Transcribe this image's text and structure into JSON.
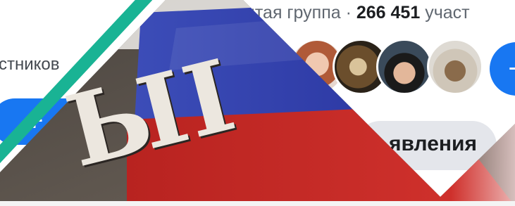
{
  "group": {
    "meta_prefix": "рытая группа · ",
    "members_count": "266 451",
    "meta_suffix": " участ"
  },
  "members_caption": "стников",
  "actions": {
    "join_symbol": "+",
    "invite_symbol": "+"
  },
  "tabs": {
    "active_label": "явления"
  },
  "cover": {
    "letters": "ЫI"
  },
  "colors": {
    "accent": "#1877f2",
    "stripe": "#19b394",
    "chip": "#e4e6eb",
    "flag_white": "#ffffff",
    "flag_blue": "#2f3fb4",
    "flag_red": "#c42a27"
  }
}
